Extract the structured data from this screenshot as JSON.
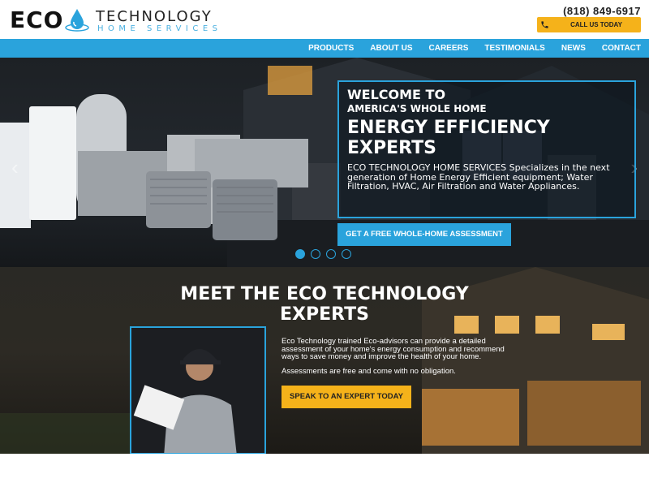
{
  "header": {
    "logo_eco": "ECO",
    "logo_technology": "TECHNOLOGY",
    "logo_home_services": "HOME SERVICES",
    "phone": "(818) 849-6917",
    "call_label": "CALL US TODAY",
    "call_icon": "phone-icon"
  },
  "nav": {
    "items": [
      {
        "label": "PRODUCTS"
      },
      {
        "label": "ABOUT US"
      },
      {
        "label": "CAREERS"
      },
      {
        "label": "TESTIMONIALS"
      },
      {
        "label": "NEWS"
      },
      {
        "label": "CONTACT"
      }
    ]
  },
  "hero": {
    "welcome": "WELCOME TO",
    "america": "AMERICA'S WHOLE HOME",
    "energy_line1": "ENERGY EFFICIENCY",
    "energy_line2": "EXPERTS",
    "description": "ECO TECHNOLOGY HOME SERVICES Specializes in the next generation of Home Energy Efficient equipment; Water Filtration, HVAC, Air Filtration and Water Appliances.",
    "cta": "GET A FREE WHOLE-HOME ASSESSMENT",
    "slides": 4,
    "active_slide": 1,
    "prev_icon": "chevron-left-icon",
    "next_icon": "chevron-right-icon"
  },
  "meet": {
    "title_line1": "MEET THE ECO TECHNOLOGY",
    "title_line2": "EXPERTS",
    "paragraph1": "Eco Technology trained Eco-advisors can provide a detailed assessment of your home's energy consumption and recommend ways to save money and improve the health of your home.",
    "paragraph2": "Assessments are free and come with no obligation.",
    "cta": "SPEAK TO AN EXPERT TODAY"
  },
  "colors": {
    "accent_blue": "#2aa3dc",
    "accent_yellow": "#f5b21a"
  }
}
